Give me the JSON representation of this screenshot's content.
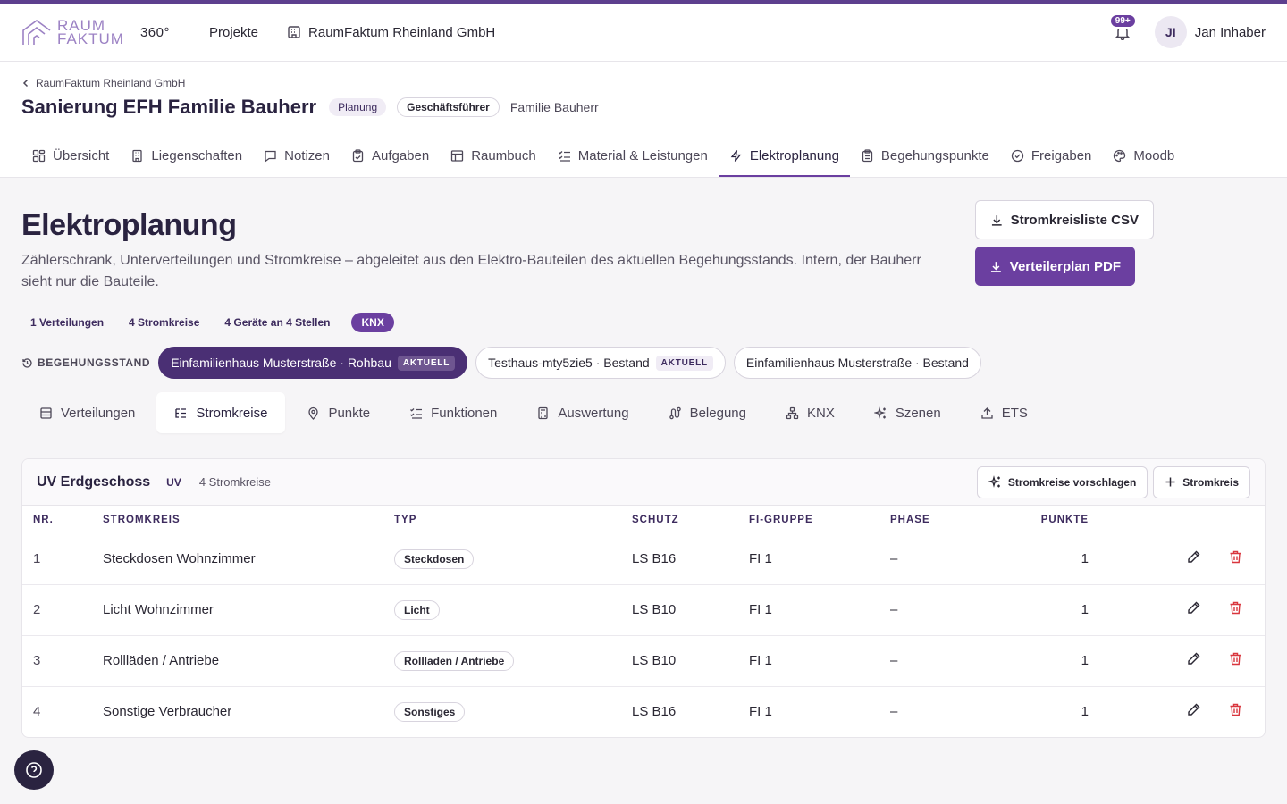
{
  "topbar": {
    "logo_line1": "RAUM",
    "logo_line2": "FAKTUM",
    "logo_suffix": "360°",
    "nav_projects": "Projekte",
    "company": "RaumFaktum Rheinland GmbH",
    "notif_badge": "99+",
    "avatar_initials": "JI",
    "username": "Jan Inhaber"
  },
  "project": {
    "breadcrumb": "RaumFaktum Rheinland GmbH",
    "title": "Sanierung EFH Familie Bauherr",
    "status": "Planung",
    "role": "Geschäftsführer",
    "client": "Familie Bauherr",
    "tabs": [
      {
        "label": "Übersicht",
        "icon": "grid-icon"
      },
      {
        "label": "Liegenschaften",
        "icon": "building-icon"
      },
      {
        "label": "Notizen",
        "icon": "note-icon"
      },
      {
        "label": "Aufgaben",
        "icon": "clipboard-check-icon"
      },
      {
        "label": "Raumbuch",
        "icon": "table-icon"
      },
      {
        "label": "Material & Leistungen",
        "icon": "list-check-icon"
      },
      {
        "label": "Elektroplanung",
        "icon": "lightning-icon"
      },
      {
        "label": "Begehungspunkte",
        "icon": "clipboard-icon"
      },
      {
        "label": "Freigaben",
        "icon": "check-circle-icon"
      },
      {
        "label": "Moodb",
        "icon": "palette-icon"
      }
    ],
    "active_tab": "Elektroplanung"
  },
  "page": {
    "title": "Elektroplanung",
    "description": "Zählerschrank, Unterverteilungen und Stromkreise – abgeleitet aus den Elektro-Bauteilen des aktuellen Begehungsstands. Intern, der Bauherr sieht nur die Bauteile.",
    "btn_csv": "Stromkreisliste CSV",
    "btn_pdf": "Verteilerplan PDF"
  },
  "stats": {
    "verteilungen": "1 Verteilungen",
    "stromkreise": "4 Stromkreise",
    "geraete": "4 Geräte an 4 Stellen",
    "knx": "KNX"
  },
  "stand": {
    "label": "BEGEHUNGSSTAND",
    "chips": [
      {
        "label": "Einfamilienhaus Musterstraße · Rohbau",
        "badge": "AKTUELL"
      },
      {
        "label": "Testhaus-mty5zie5 · Bestand",
        "badge": "AKTUELL"
      },
      {
        "label": "Einfamilienhaus Musterstraße · Bestand",
        "badge": ""
      }
    ]
  },
  "subtabs": [
    {
      "label": "Verteilungen",
      "icon": "panel-icon"
    },
    {
      "label": "Stromkreise",
      "icon": "list-tree-icon"
    },
    {
      "label": "Punkte",
      "icon": "map-pin-icon"
    },
    {
      "label": "Funktionen",
      "icon": "list-check-icon"
    },
    {
      "label": "Auswertung",
      "icon": "calculator-icon"
    },
    {
      "label": "Belegung",
      "icon": "route-icon"
    },
    {
      "label": "KNX",
      "icon": "network-icon"
    },
    {
      "label": "Szenen",
      "icon": "sparkles-icon"
    },
    {
      "label": "ETS",
      "icon": "upload-icon"
    }
  ],
  "active_subtab": "Stromkreise",
  "card": {
    "title": "UV Erdgeschoss",
    "tag": "UV",
    "count": "4 Stromkreise",
    "btn_suggest": "Stromkreise vorschlagen",
    "btn_add": "Stromkreis",
    "columns": [
      "NR.",
      "STROMKREIS",
      "TYP",
      "SCHUTZ",
      "FI-GRUPPE",
      "PHASE",
      "PUNKTE"
    ],
    "rows": [
      {
        "nr": "1",
        "name": "Steckdosen Wohnzimmer",
        "typ": "Steckdosen",
        "schutz": "LS B16",
        "fi": "FI 1",
        "phase": "–",
        "punkte": "1"
      },
      {
        "nr": "2",
        "name": "Licht Wohnzimmer",
        "typ": "Licht",
        "schutz": "LS B10",
        "fi": "FI 1",
        "phase": "–",
        "punkte": "1"
      },
      {
        "nr": "3",
        "name": "Rollläden / Antriebe",
        "typ": "Rollladen / Antriebe",
        "schutz": "LS B10",
        "fi": "FI 1",
        "phase": "–",
        "punkte": "1"
      },
      {
        "nr": "4",
        "name": "Sonstige Verbraucher",
        "typ": "Sonstiges",
        "schutz": "LS B16",
        "fi": "FI 1",
        "phase": "–",
        "punkte": "1"
      }
    ]
  },
  "colors": {
    "accent": "#6b3fa0",
    "accent_dark": "#4a2f74",
    "danger": "#d9363e"
  }
}
